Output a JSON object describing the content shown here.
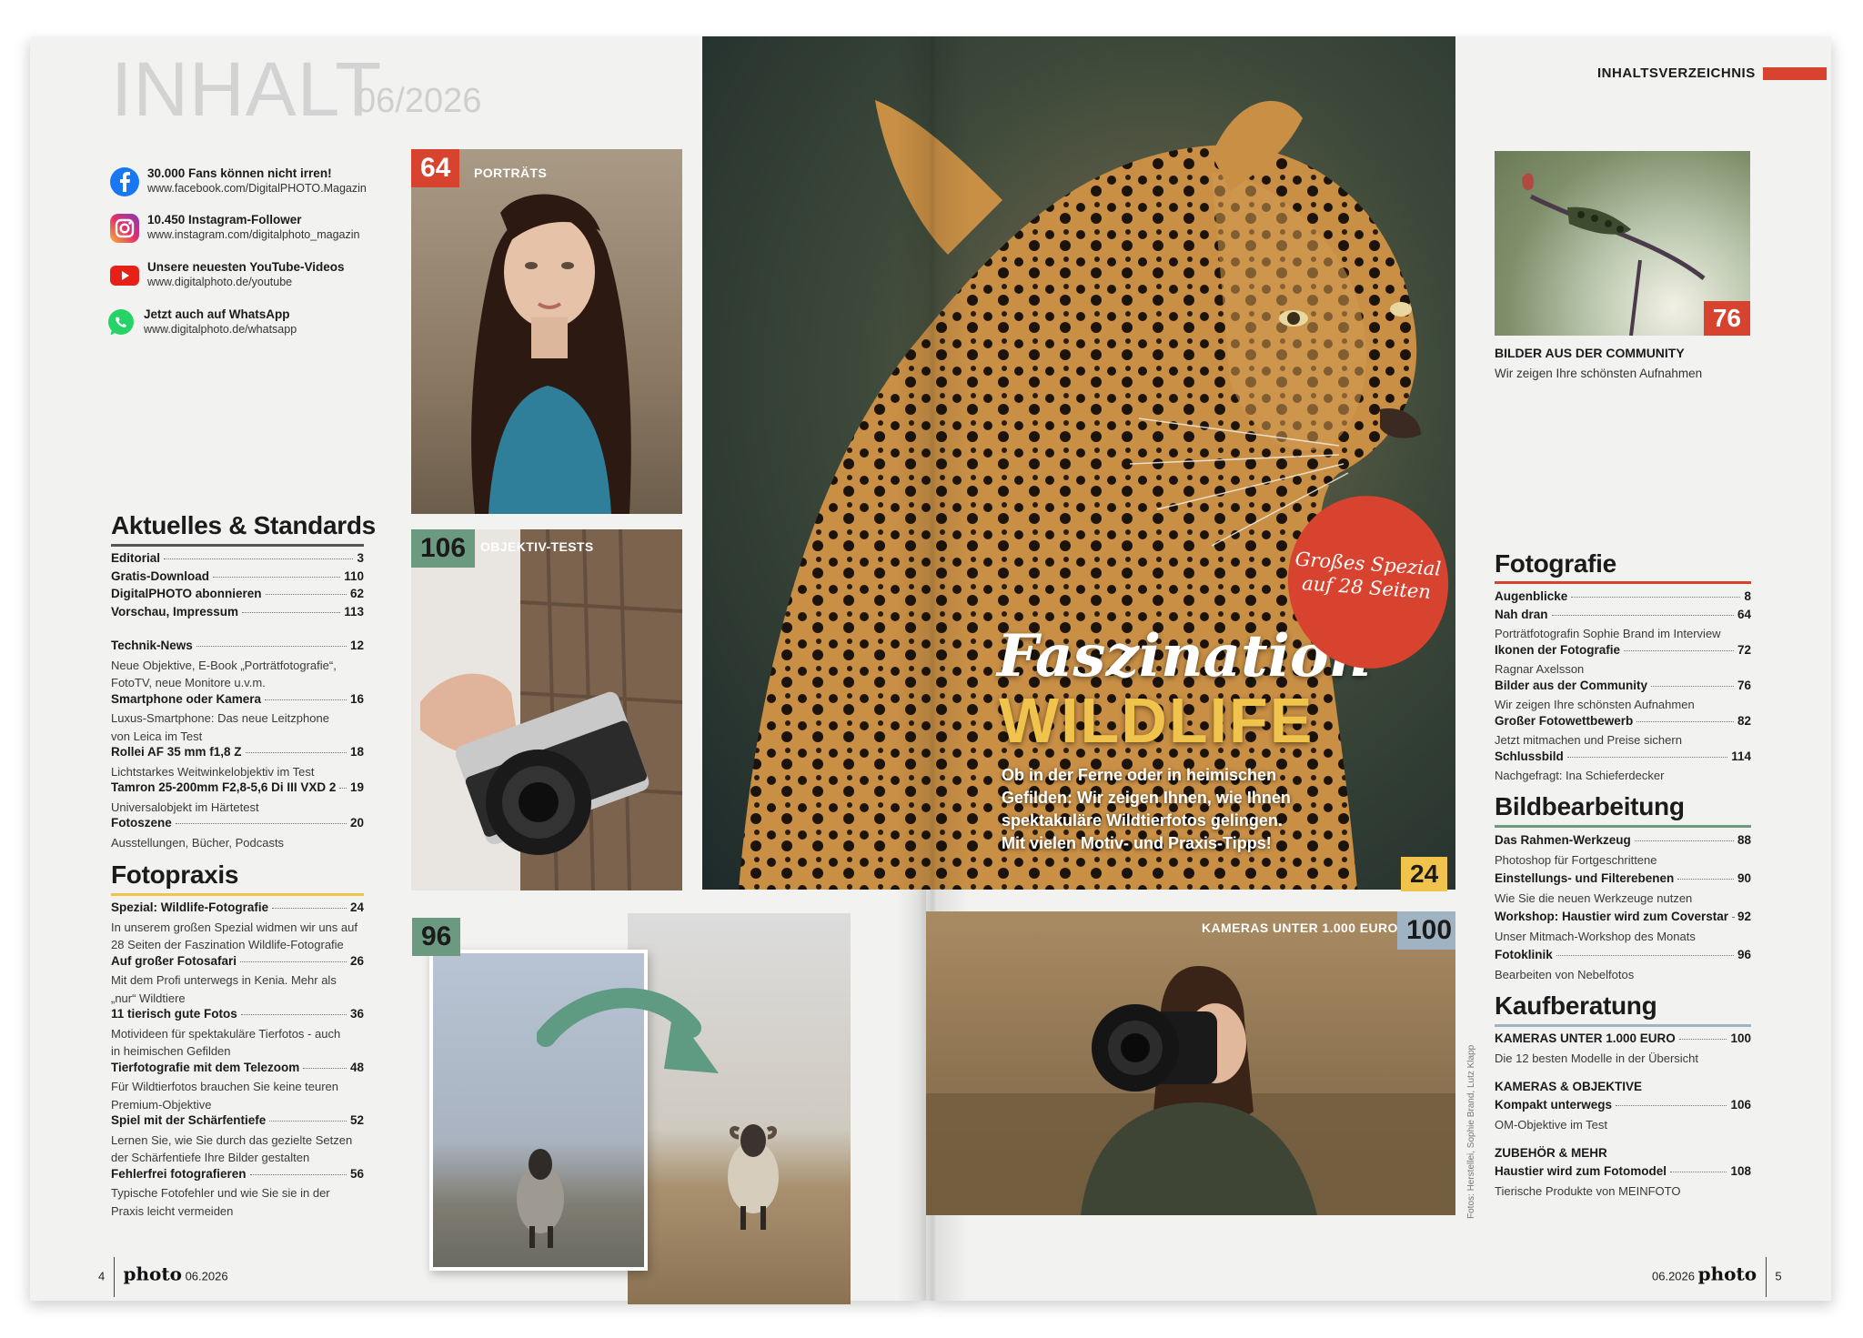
{
  "left": {
    "title": "INHALT",
    "issue": "06/2026",
    "social": [
      {
        "icon": "facebook-icon",
        "line1": "30.000 Fans können nicht irren!",
        "line2": "www.facebook.com/DigitalPHOTO.Magazin"
      },
      {
        "icon": "instagram-icon",
        "line1": "10.450 Instagram-Follower",
        "line2": "www.instagram.com/digitalphoto_magazin"
      },
      {
        "icon": "youtube-icon",
        "line1": "Unsere neuesten YouTube-Videos",
        "line2": "www.digitalphoto.de/youtube"
      },
      {
        "icon": "whatsapp-icon",
        "line1": "Jetzt auch auf WhatsApp",
        "line2": "www.digitalphoto.de/whatsapp"
      }
    ],
    "aktuelles": {
      "title": "Aktuelles & Standards",
      "entries": [
        {
          "title": "Editorial",
          "page": "3"
        },
        {
          "title": "Gratis-Download",
          "page": "110"
        },
        {
          "title": "DigitalPHOTO abonnieren",
          "page": "62"
        },
        {
          "title": "Vorschau, Impressum",
          "page": "113"
        }
      ],
      "entries2": [
        {
          "title": "Technik-News",
          "page": "12",
          "desc": [
            "Neue Objektive, E-Book „Porträtfotografie“,",
            "FotoTV, neue Monitore u.v.m."
          ]
        },
        {
          "title": "Smartphone oder Kamera",
          "page": "16",
          "desc": [
            "Luxus-Smartphone: Das neue Leitzphone",
            "von Leica im Test"
          ]
        },
        {
          "title": "Rollei AF 35 mm f1,8 Z",
          "page": "18",
          "desc": [
            "Lichtstarkes Weitwinkelobjektiv im Test"
          ]
        },
        {
          "title": "Tamron 25-200mm F2,8-5,6 Di III VXD 2",
          "page": "19",
          "desc": [
            "Universalobjekt im Härtetest"
          ]
        },
        {
          "title": "Fotoszene",
          "page": "20",
          "desc": [
            "Ausstellungen, Bücher, Podcasts"
          ]
        }
      ]
    },
    "fotopraxis": {
      "title": "Fotopraxis",
      "entries": [
        {
          "title": "Spezial: Wildlife-Fotografie",
          "page": "24",
          "desc": [
            "In unserem großen Spezial widmen wir uns auf",
            "28 Seiten der Faszination Wildlife-Fotografie"
          ]
        },
        {
          "title": "Auf großer Fotosafari",
          "page": "26",
          "desc": [
            "Mit dem Profi unterwegs in Kenia. Mehr als",
            "„nur“ Wildtiere"
          ]
        },
        {
          "title": "11 tierisch gute Fotos",
          "page": "36",
          "desc": [
            "Motivideen für spektakuläre Tierfotos - auch",
            "in heimischen Gefilden"
          ]
        },
        {
          "title": "Tierfotografie mit dem Telezoom",
          "page": "48",
          "desc": [
            "Für Wildtierfotos brauchen Sie keine teuren",
            "Premium-Objektive"
          ]
        },
        {
          "title": "Spiel mit der Schärfentiefe",
          "page": "52",
          "desc": [
            "Lernen Sie, wie Sie durch das gezielte Setzen",
            "der Schärfentiefe Ihre Bilder gestalten"
          ]
        },
        {
          "title": "Fehlerfrei fotografieren",
          "page": "56",
          "desc": [
            "Typische Fotofehler und wie Sie sie in der",
            "Praxis leicht vermeiden"
          ]
        }
      ]
    },
    "photos": {
      "portrait_badge": "64",
      "portrait_tag": "PORTRÄTS",
      "lens_badge": "106",
      "lens_tag": "OBJEKTIV-TESTS",
      "sheep_badge": "96"
    },
    "folio": {
      "page": "4",
      "logo": "photo",
      "date": "06.2026"
    }
  },
  "center": {
    "title_script": "Faszination",
    "title_caps": "WILDLIFE",
    "teaser": [
      "Ob in der Ferne oder in heimischen",
      "Gefilden: Wir zeigen Ihnen, wie Ihnen",
      "spektakuläre Wildtierfotos gelingen.",
      "Mit vielen Motiv- und Praxis-Tipps!"
    ],
    "special_badge": [
      "Großes Spezial",
      "auf 28 Seiten"
    ],
    "page_badge": "24",
    "camera_tag": "KAMERAS UNTER 1.000 EURO",
    "camera_badge": "100",
    "credits": "Fotos: Herstellei, Sophie Brand, Lutz Klapp"
  },
  "right": {
    "header": "INHALTSVERZEICHNIS",
    "community": {
      "badge": "76",
      "title": "BILDER AUS DER COMMUNITY",
      "sub": "Wir zeigen Ihre schönsten Aufnahmen"
    },
    "fotografie": {
      "title": "Fotografie",
      "entries": [
        {
          "title": "Augenblicke",
          "page": "8",
          "desc": []
        },
        {
          "title": "Nah dran",
          "page": "64",
          "desc": [
            "Porträtfotografin Sophie Brand im Interview"
          ]
        },
        {
          "title": "Ikonen der Fotografie",
          "page": "72",
          "desc": [
            "Ragnar Axelsson"
          ]
        },
        {
          "title": "Bilder aus der Community",
          "page": "76",
          "desc": [
            "Wir zeigen Ihre schönsten Aufnahmen"
          ]
        },
        {
          "title": "Großer Fotowettbewerb",
          "page": "82",
          "desc": [
            "Jetzt mitmachen und Preise sichern"
          ]
        },
        {
          "title": "Schlussbild",
          "page": "114",
          "desc": [
            "Nachgefragt: Ina Schieferdecker"
          ]
        }
      ]
    },
    "bildbearbeitung": {
      "title": "Bildbearbeitung",
      "entries": [
        {
          "title": "Das Rahmen-Werkzeug",
          "page": "88",
          "desc": [
            "Photoshop für Fortgeschrittene"
          ]
        },
        {
          "title": "Einstellungs- und Filterebenen",
          "page": "90",
          "desc": [
            "Wie Sie die neuen Werkzeuge nutzen"
          ]
        },
        {
          "title": "Workshop: Haustier wird zum Coverstar",
          "page": "92",
          "desc": [
            "Unser Mitmach-Workshop des Monats"
          ]
        },
        {
          "title": "Fotoklinik",
          "page": "96",
          "desc": [
            "Bearbeiten von Nebelfotos"
          ]
        }
      ]
    },
    "kaufberatung": {
      "title": "Kaufberatung",
      "groups": [
        {
          "sub": "",
          "entries": [
            {
              "title": "KAMERAS UNTER 1.000 EURO",
              "page": "100",
              "desc": [
                "Die 12 besten Modelle in der Übersicht"
              ]
            }
          ]
        },
        {
          "sub": "KAMERAS & OBJEKTIVE",
          "entries": [
            {
              "title": "Kompakt unterwegs",
              "page": "106",
              "desc": [
                "OM-Objektive im Test"
              ]
            }
          ]
        },
        {
          "sub": "ZUBEHÖR & MEHR",
          "entries": [
            {
              "title": "Haustier wird zum Fotomodel",
              "page": "108",
              "desc": [
                "Tierische Produkte von MEINFOTO"
              ]
            }
          ]
        }
      ]
    },
    "folio": {
      "date": "06.2026",
      "logo": "photo",
      "page": "5"
    }
  },
  "colors": {
    "red": "#d8432f",
    "yellow": "#f0c44c",
    "green": "#6c9a80",
    "blue_grey": "#9fb3c2",
    "grey_text": "#d3d3d3"
  }
}
